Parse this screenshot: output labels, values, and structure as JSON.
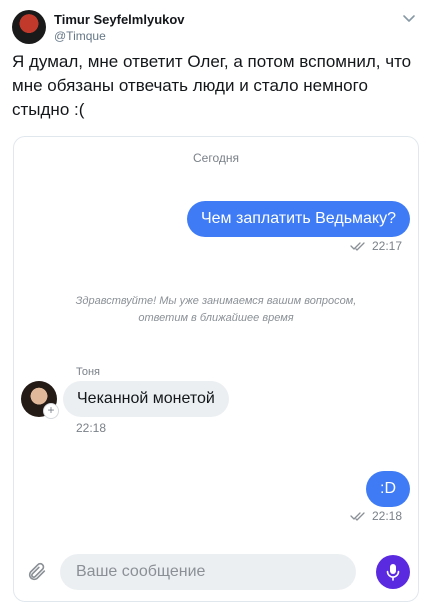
{
  "tweet": {
    "author_name": "Timur Seyfelmlyukov",
    "author_handle": "@Timque",
    "text": "Я думал, мне ответит Олег, а потом вспомнил, что мне обязаны отвечать люди и стало немного стыдно :("
  },
  "chat": {
    "date_label": "Сегодня",
    "messages": [
      {
        "direction": "outgoing",
        "text": "Чем заплатить Ведьмаку?",
        "time": "22:17"
      },
      {
        "direction": "system",
        "text": "Здравствуйте! Мы уже занимаемся вашим вопросом, ответим в ближайшее время"
      },
      {
        "direction": "incoming",
        "sender": "Тоня",
        "text": "Чеканной монетой",
        "time": "22:18"
      },
      {
        "direction": "outgoing",
        "text": ":D",
        "time": "22:18"
      }
    ],
    "composer": {
      "placeholder": "Ваше сообщение",
      "value": ""
    }
  },
  "colors": {
    "outgoing_bubble": "#3f7bf5",
    "incoming_bubble": "#eceff2",
    "mic_button": "#5a2ae0"
  },
  "icons": [
    "chevron-down-icon",
    "double-check-icon",
    "paperclip-icon",
    "microphone-icon"
  ]
}
